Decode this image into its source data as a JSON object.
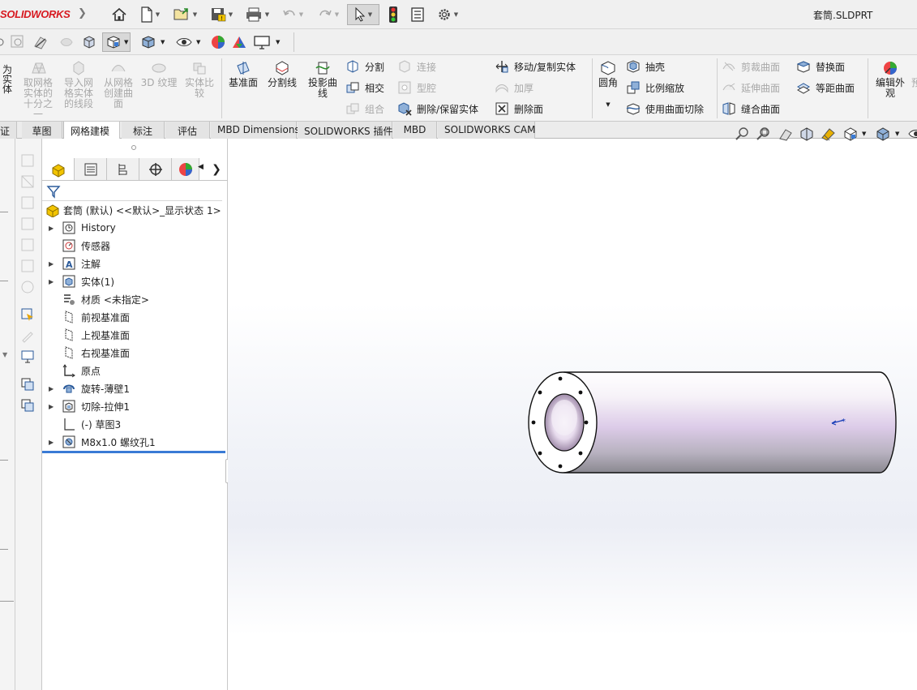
{
  "app": {
    "logo_text": "SOLIDWORKS",
    "document_title": "套筒.SLDPRT"
  },
  "quick_access": [
    {
      "name": "home-icon"
    },
    {
      "name": "new-document-icon"
    },
    {
      "name": "open-icon"
    },
    {
      "name": "save-icon"
    },
    {
      "name": "print-icon"
    },
    {
      "name": "undo-icon"
    },
    {
      "name": "redo-icon"
    },
    {
      "name": "select-pointer-icon"
    },
    {
      "name": "rebuild-icon"
    },
    {
      "name": "file-properties-icon"
    },
    {
      "name": "options-gear-icon"
    }
  ],
  "ribbon": {
    "left_partial": [
      "为\n实\n体",
      "转换为"
    ],
    "big_buttons": [
      {
        "label": "取网格\n实体的\n十分之\n一",
        "enabled": false
      },
      {
        "label": "导入网\n格实体\n的线段",
        "enabled": false
      },
      {
        "label": "从网格\n创建曲\n面",
        "enabled": false
      },
      {
        "label": "3D 纹理",
        "enabled": false
      },
      {
        "label": "实体比\n较",
        "enabled": false
      },
      {
        "label": "基准面",
        "enabled": true
      },
      {
        "label": "分割线",
        "enabled": true
      },
      {
        "label": "投影曲\n线",
        "enabled": true
      }
    ],
    "col1": [
      {
        "label": "分割",
        "enabled": true
      },
      {
        "label": "相交",
        "enabled": true
      },
      {
        "label": "组合",
        "enabled": false
      }
    ],
    "col2": [
      {
        "label": "连接",
        "enabled": false
      },
      {
        "label": "型腔",
        "enabled": false
      },
      {
        "label": "删除/保留实体",
        "enabled": true
      }
    ],
    "col3": [
      {
        "label": "移动/复制实体",
        "enabled": true
      },
      {
        "label": "加厚",
        "enabled": false
      },
      {
        "label": "删除面",
        "enabled": true
      }
    ],
    "fillet": {
      "label": "圆角"
    },
    "col4": [
      {
        "label": "抽壳",
        "enabled": true
      },
      {
        "label": "比例缩放",
        "enabled": true
      },
      {
        "label": "使用曲面切除",
        "enabled": true
      }
    ],
    "col5": [
      {
        "label": "剪裁曲面",
        "enabled": false
      },
      {
        "label": "延伸曲面",
        "enabled": false
      },
      {
        "label": "缝合曲面",
        "enabled": true
      }
    ],
    "col6": [
      {
        "label": "替换面",
        "enabled": true
      },
      {
        "label": "等距曲面",
        "enabled": true
      }
    ],
    "edit_appearance": {
      "label": "编辑外\n观"
    },
    "right_partial": "预"
  },
  "tabs": [
    {
      "label": "证"
    },
    {
      "label": "草图"
    },
    {
      "label": "网格建模",
      "active": true
    },
    {
      "label": "标注"
    },
    {
      "label": "评估"
    },
    {
      "label": "MBD Dimensions"
    },
    {
      "label": "SOLIDWORKS 插件"
    },
    {
      "label": "MBD"
    },
    {
      "label": "SOLIDWORKS CAM"
    }
  ],
  "feature_tree": {
    "root": "套筒 (默认) <<默认>_显示状态 1>",
    "items": [
      {
        "label": "History",
        "expandable": true,
        "icon": "history-icon"
      },
      {
        "label": "传感器",
        "expandable": false,
        "icon": "sensor-icon"
      },
      {
        "label": "注解",
        "expandable": true,
        "icon": "annotation-icon"
      },
      {
        "label": "实体(1)",
        "expandable": true,
        "icon": "solid-body-icon"
      },
      {
        "label": "材质 <未指定>",
        "expandable": false,
        "icon": "material-icon"
      },
      {
        "label": "前视基准面",
        "expandable": false,
        "icon": "plane-icon"
      },
      {
        "label": "上视基准面",
        "expandable": false,
        "icon": "plane-icon"
      },
      {
        "label": "右视基准面",
        "expandable": false,
        "icon": "plane-icon"
      },
      {
        "label": "原点",
        "expandable": false,
        "icon": "origin-icon"
      },
      {
        "label": "旋转-薄壁1",
        "expandable": true,
        "icon": "revolve-icon"
      },
      {
        "label": "切除-拉伸1",
        "expandable": true,
        "icon": "cut-extrude-icon"
      },
      {
        "label": "(-) 草图3",
        "expandable": false,
        "icon": "sketch-icon"
      },
      {
        "label": "M8x1.0 螺纹孔1",
        "expandable": true,
        "icon": "hole-wizard-icon"
      }
    ]
  },
  "colors": {
    "accent_blue": "#3a7bd5",
    "logo_red": "#d71920",
    "part_purple": "#d9c8e6"
  }
}
